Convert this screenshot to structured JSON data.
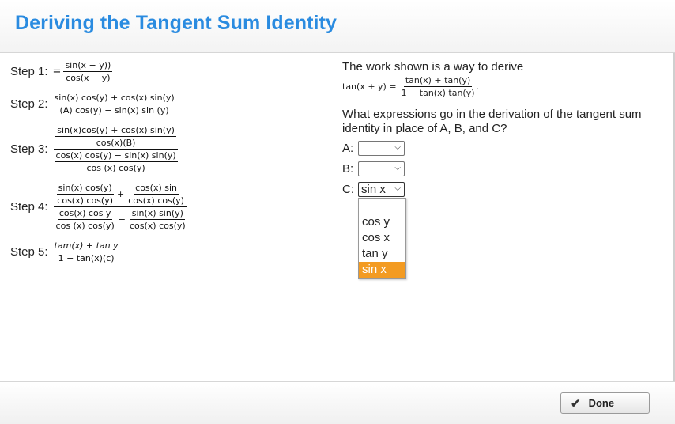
{
  "title": "Deriving the Tangent Sum Identity",
  "steps": {
    "s1": {
      "label": "Step 1:",
      "eq": "=",
      "num": "sin(x − y))",
      "den": "cos(x − y)"
    },
    "s2": {
      "label": "Step 2:",
      "num": "sin(x) cos(y) + cos(x) sin(y)",
      "den": "(A) cos(y) − sin(x) sin (y)"
    },
    "s3": {
      "label": "Step 3:",
      "num_num": "sin(x)cos(y) + cos(x) sin(y)",
      "num_den": "cos(x)(B)",
      "den_num": "cos(x) cos(y) − sin(x) sin(y)",
      "den_den": "cos (x) cos(y)"
    },
    "s4": {
      "label": "Step 4:",
      "a_num": "sin(x) cos(y)",
      "a_den": "cos(x) cos(y)",
      "plus": "+",
      "b_num": "cos(x) sin",
      "b_den": "cos(x) cos(y)",
      "c_num": "cos(x) cos y",
      "c_den": "cos (x) cos(y)",
      "minus": "−",
      "d_num": "sin(x) sin(y)",
      "d_den": "cos(x) cos(y)"
    },
    "s5": {
      "label": "Step 5:",
      "num": "tam(x) + tan y",
      "den": "1 − tan(x)(c)"
    }
  },
  "right": {
    "prompt1": "The work shown is a way to derive",
    "identity_lhs": "tan(x + y) =",
    "identity_num": "tan(x) + tan(y)",
    "identity_den": "1 − tan(x) tan(y)",
    "identity_end": ".",
    "prompt2": "What expressions go in the derivation of the tangent sum identity in place of A, B, and C?",
    "a_label": "A:",
    "a_value": "",
    "b_label": "B:",
    "b_value": "",
    "c_label": "C:",
    "c_value": "sin x",
    "options": [
      "",
      "cos y",
      "cos x",
      "tan y",
      "sin x"
    ],
    "highlighted": "sin x"
  },
  "footer": {
    "done_label": "Done"
  }
}
